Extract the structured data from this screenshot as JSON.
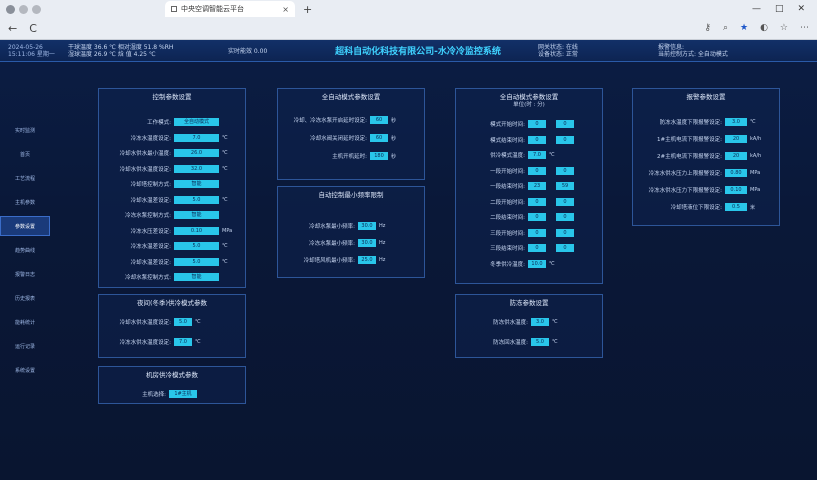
{
  "browser": {
    "tab_title": "中央空调智能云平台",
    "close": "×",
    "new_tab": "+",
    "win_min": "—",
    "win_max": "□",
    "win_close": "✕",
    "back": "←",
    "reload": "C",
    "star": "★"
  },
  "header": {
    "date": "2024-05-26",
    "time": "15:11:06 星期一",
    "env_line1": "干球温度 36.6 ℃ 相对湿度 51.8 %RH",
    "env_line2": "湿球温度 26.9 ℃ 焓 值 4.25 ℃",
    "realtime": "实时能效 0.00",
    "title": "超科自动化科技有限公司-水冷冷监控系统",
    "status_line1": "网关状态: 在线",
    "status_line2": "设备状态: 正常",
    "alarm_line1": "报警信息:",
    "alarm_line2": "当前控制方式: 全自动模式"
  },
  "sidebar": {
    "items": [
      "实时监测",
      "首页",
      "工艺流程",
      "主机参数",
      "参数设置",
      "趋势曲线",
      "报警日志",
      "历史报表",
      "能耗统计",
      "运行记录",
      "系统设置"
    ]
  },
  "colors": {
    "accent": "#29c6ea",
    "title": "#3fd2ff",
    "panel_border": "#2d5598",
    "bg": "#0a1838"
  },
  "panels": {
    "control": {
      "title": "控制参数设置",
      "rows": [
        {
          "label": "工作模式:",
          "value": "全自动模式",
          "unit": ""
        },
        {
          "label": "冷冻水温度设定:",
          "value": "7.0",
          "unit": "℃"
        },
        {
          "label": "冷却水供水最小温度:",
          "value": "26.0",
          "unit": "℃"
        },
        {
          "label": "冷却水供水温度设定:",
          "value": "32.0",
          "unit": "℃"
        },
        {
          "label": "冷却塔控制方式:",
          "value": "智能",
          "unit": ""
        },
        {
          "label": "冷却水温差设定:",
          "value": "5.0",
          "unit": "℃"
        },
        {
          "label": "冷冻水泵控制方式:",
          "value": "智能",
          "unit": ""
        },
        {
          "label": "冷冻水压差设定:",
          "value": "0.10",
          "unit": "MPa"
        },
        {
          "label": "冷冻水温差设定:",
          "value": "5.0",
          "unit": "℃"
        },
        {
          "label": "冷却水温差设定:",
          "value": "5.0",
          "unit": "℃"
        },
        {
          "label": "冷却水泵控制方式:",
          "value": "智能",
          "unit": ""
        }
      ]
    },
    "winter": {
      "title": "夜间(冬季)供冷模式参数",
      "rows": [
        {
          "label": "冷却水供水温度设定:",
          "value": "5.0",
          "unit": "℃"
        },
        {
          "label": "冷冻水供水温度设定:",
          "value": "7.0",
          "unit": "℃"
        }
      ]
    },
    "machine": {
      "title": "机房供冷模式参数",
      "rows": [
        {
          "label": "主机选择:",
          "value": "1#主机",
          "unit": ""
        }
      ]
    },
    "fullauto": {
      "title": "全自动模式参数设置",
      "rows": [
        {
          "label": "冷却、冷冻水泵开启延时设定:",
          "value": "60",
          "unit": "秒"
        },
        {
          "label": "冷却水阀关闭延时设定:",
          "value": "60",
          "unit": "秒"
        },
        {
          "label": "主机开机延时:",
          "value": "180",
          "unit": "秒"
        }
      ]
    },
    "minfreq": {
      "title": "自动控制最小频率限制",
      "rows": [
        {
          "label": "冷却水泵最小频率:",
          "value": "30.0",
          "unit": "Hz"
        },
        {
          "label": "冷冻水泵最小频率:",
          "value": "30.0",
          "unit": "Hz"
        },
        {
          "label": "冷却塔风机最小频率:",
          "value": "25.0",
          "unit": "Hz"
        }
      ]
    },
    "timing": {
      "title": "全自动模式参数设置",
      "subtitle": "单位(时 : 分)",
      "rows": [
        {
          "label": "模式开始时间:",
          "v1": "0",
          "v2": "0",
          "unit": ""
        },
        {
          "label": "模式结束时间:",
          "v1": "0",
          "v2": "0",
          "unit": ""
        },
        {
          "label": "供冷模式温度:",
          "v1": "7.0",
          "v2": "",
          "unit": "℃"
        },
        {
          "label": "一段开始时间:",
          "v1": "0",
          "v2": "0",
          "unit": ""
        },
        {
          "label": "一段结束时间:",
          "v1": "23",
          "v2": "59",
          "unit": ""
        },
        {
          "label": "二段开始时间:",
          "v1": "0",
          "v2": "0",
          "unit": ""
        },
        {
          "label": "二段结束时间:",
          "v1": "0",
          "v2": "0",
          "unit": ""
        },
        {
          "label": "三段开始时间:",
          "v1": "0",
          "v2": "0",
          "unit": ""
        },
        {
          "label": "三段结束时间:",
          "v1": "0",
          "v2": "0",
          "unit": ""
        },
        {
          "label": "冬季供冷温度:",
          "v1": "10.0",
          "v2": "",
          "unit": "℃"
        }
      ]
    },
    "antifreeze": {
      "title": "防冻参数设置",
      "rows": [
        {
          "label": "防冻供水温度:",
          "value": "3.0",
          "unit": "℃"
        },
        {
          "label": "防冻回水温度:",
          "value": "5.0",
          "unit": "℃"
        }
      ]
    },
    "alarm": {
      "title": "报警参数设置",
      "rows": [
        {
          "label": "防冻水温度下限报警设定:",
          "value": "3.0",
          "unit": "℃"
        },
        {
          "label": "1#主机电流下限报警设定:",
          "value": "20",
          "unit": "kA/h"
        },
        {
          "label": "2#主机电流下限报警设定:",
          "value": "20",
          "unit": "kA/h"
        },
        {
          "label": "冷冻水供水压力上限报警设定:",
          "value": "0.80",
          "unit": "MPa"
        },
        {
          "label": "冷冻水供水压力下限报警设定:",
          "value": "0.10",
          "unit": "MPa"
        },
        {
          "label": "冷却塔液位下限设定:",
          "value": "0.5",
          "unit": "米"
        }
      ]
    }
  }
}
